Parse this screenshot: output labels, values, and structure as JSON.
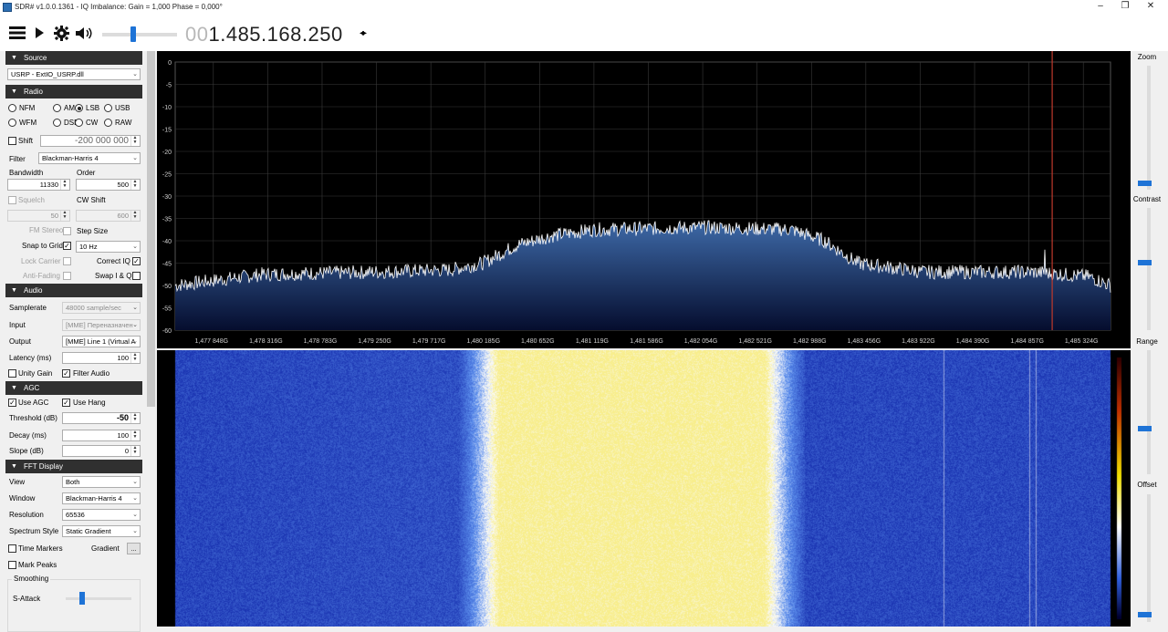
{
  "window": {
    "title": "SDR# v1.0.0.1361 - IQ Imbalance: Gain = 1,000 Phase = 0,000°",
    "controls": [
      "minimize",
      "restore",
      "close"
    ]
  },
  "toolbar": {
    "icons": [
      "menu-icon",
      "play-icon",
      "gear-icon",
      "speaker-icon"
    ],
    "volume_level": 0.42,
    "frequency_dim": "00",
    "frequency_main": "1.485.168.250",
    "freq_arrows": "◂▸"
  },
  "source": {
    "header": "Source",
    "device": "USRP - ExtIO_USRP.dll"
  },
  "radio": {
    "header": "Radio",
    "modes": [
      {
        "label": "NFM",
        "selected": false
      },
      {
        "label": "AM",
        "selected": false
      },
      {
        "label": "LSB",
        "selected": true
      },
      {
        "label": "USB",
        "selected": false
      },
      {
        "label": "WFM",
        "selected": false
      },
      {
        "label": "DSB",
        "selected": false
      },
      {
        "label": "CW",
        "selected": false
      },
      {
        "label": "RAW",
        "selected": false
      }
    ],
    "shift_label": "Shift",
    "shift_value": "-200 000 000",
    "filter_label": "Filter",
    "filter_value": "Blackman-Harris 4",
    "bandwidth_label": "Bandwidth",
    "bandwidth_value": "11330",
    "order_label": "Order",
    "order_value": "500",
    "squelch_label": "Squelch",
    "squelch_value": "50",
    "cwshift_label": "CW Shift",
    "cwshift_value": "600",
    "fmstereo_label": "FM Stereo",
    "stepsize_label": "Step Size",
    "snap_label": "Snap to Grid",
    "snap_value": "10 Hz",
    "lockcarrier_label": "Lock Carrier",
    "correctiq_label": "Correct IQ",
    "antifading_label": "Anti-Fading",
    "swapiq_label": "Swap I & Q"
  },
  "audio": {
    "header": "Audio",
    "samplerate_label": "Samplerate",
    "samplerate_value": "48000 sample/sec",
    "input_label": "Input",
    "input_value": "[MME] Переназначен",
    "output_label": "Output",
    "output_value": "[MME] Line 1 (Virtual A",
    "latency_label": "Latency (ms)",
    "latency_value": "100",
    "unitygain_label": "Unity Gain",
    "filteraudio_label": "Filter Audio"
  },
  "agc": {
    "header": "AGC",
    "useagc_label": "Use AGC",
    "usehang_label": "Use Hang",
    "threshold_label": "Threshold (dB)",
    "threshold_value": "-50",
    "decay_label": "Decay (ms)",
    "decay_value": "100",
    "slope_label": "Slope (dB)",
    "slope_value": "0"
  },
  "fft": {
    "header": "FFT Display",
    "view_label": "View",
    "view_value": "Both",
    "window_label": "Window",
    "window_value": "Blackman-Harris 4",
    "resolution_label": "Resolution",
    "resolution_value": "65536",
    "style_label": "Spectrum Style",
    "style_value": "Static Gradient",
    "timemarkers_label": "Time Markers",
    "gradient_label": "Gradient",
    "gradient_btn": "...",
    "markpeaks_label": "Mark Peaks",
    "smoothing_label": "Smoothing",
    "sattack_label": "S-Attack"
  },
  "right_panel": {
    "zoom_label": "Zoom",
    "contrast_label": "Contrast",
    "range_label": "Range",
    "offset_label": "Offset"
  },
  "chart_data": {
    "type": "line",
    "title": "",
    "ylabel": "",
    "xlabel": "",
    "ylim": [
      -60,
      0
    ],
    "yticks": [
      "0",
      "-5",
      "-10",
      "-15",
      "-20",
      "-25",
      "-30",
      "-35",
      "-40",
      "-45",
      "-50",
      "-55",
      "-60"
    ],
    "xticks": [
      "1,477 848G",
      "1,478 316G",
      "1,478 783G",
      "1,479 250G",
      "1,479 717G",
      "1,480 185G",
      "1,480 652G",
      "1,481 119G",
      "1,481 586G",
      "1,482 054G",
      "1,482 521G",
      "1,482 988G",
      "1,483 456G",
      "1,483 922G",
      "1,484 390G",
      "1,484 857G",
      "1,485 324G"
    ],
    "x_span_ghz": [
      1.4772,
      1.4857
    ],
    "center_marker_ghz": 1.48517,
    "series": [
      {
        "x": [
          1.4772,
          1.478,
          1.479,
          1.4797,
          1.48,
          1.4803,
          1.4806,
          1.481,
          1.482,
          1.4828,
          1.4831,
          1.4834,
          1.484,
          1.485,
          1.4855,
          1.4857
        ],
        "values": [
          -50,
          -47.5,
          -47,
          -46.5,
          -45,
          -41,
          -39,
          -37.5,
          -37,
          -37.5,
          -40,
          -45,
          -47,
          -47,
          -48,
          -50
        ]
      }
    ],
    "peaks": [
      {
        "x": 1.4851,
        "value": -42
      }
    ],
    "colors": {
      "trace": "#ffffff",
      "fill_top": "#3e6aa8",
      "fill_bottom": "#050d2e",
      "grid": "#3a3a3a",
      "marker": "#c0392b"
    }
  },
  "waterfall": {
    "edge_color": "#1a3fb0",
    "mid_color": "#2f67d8",
    "hot_color": "#f8f0a0"
  }
}
